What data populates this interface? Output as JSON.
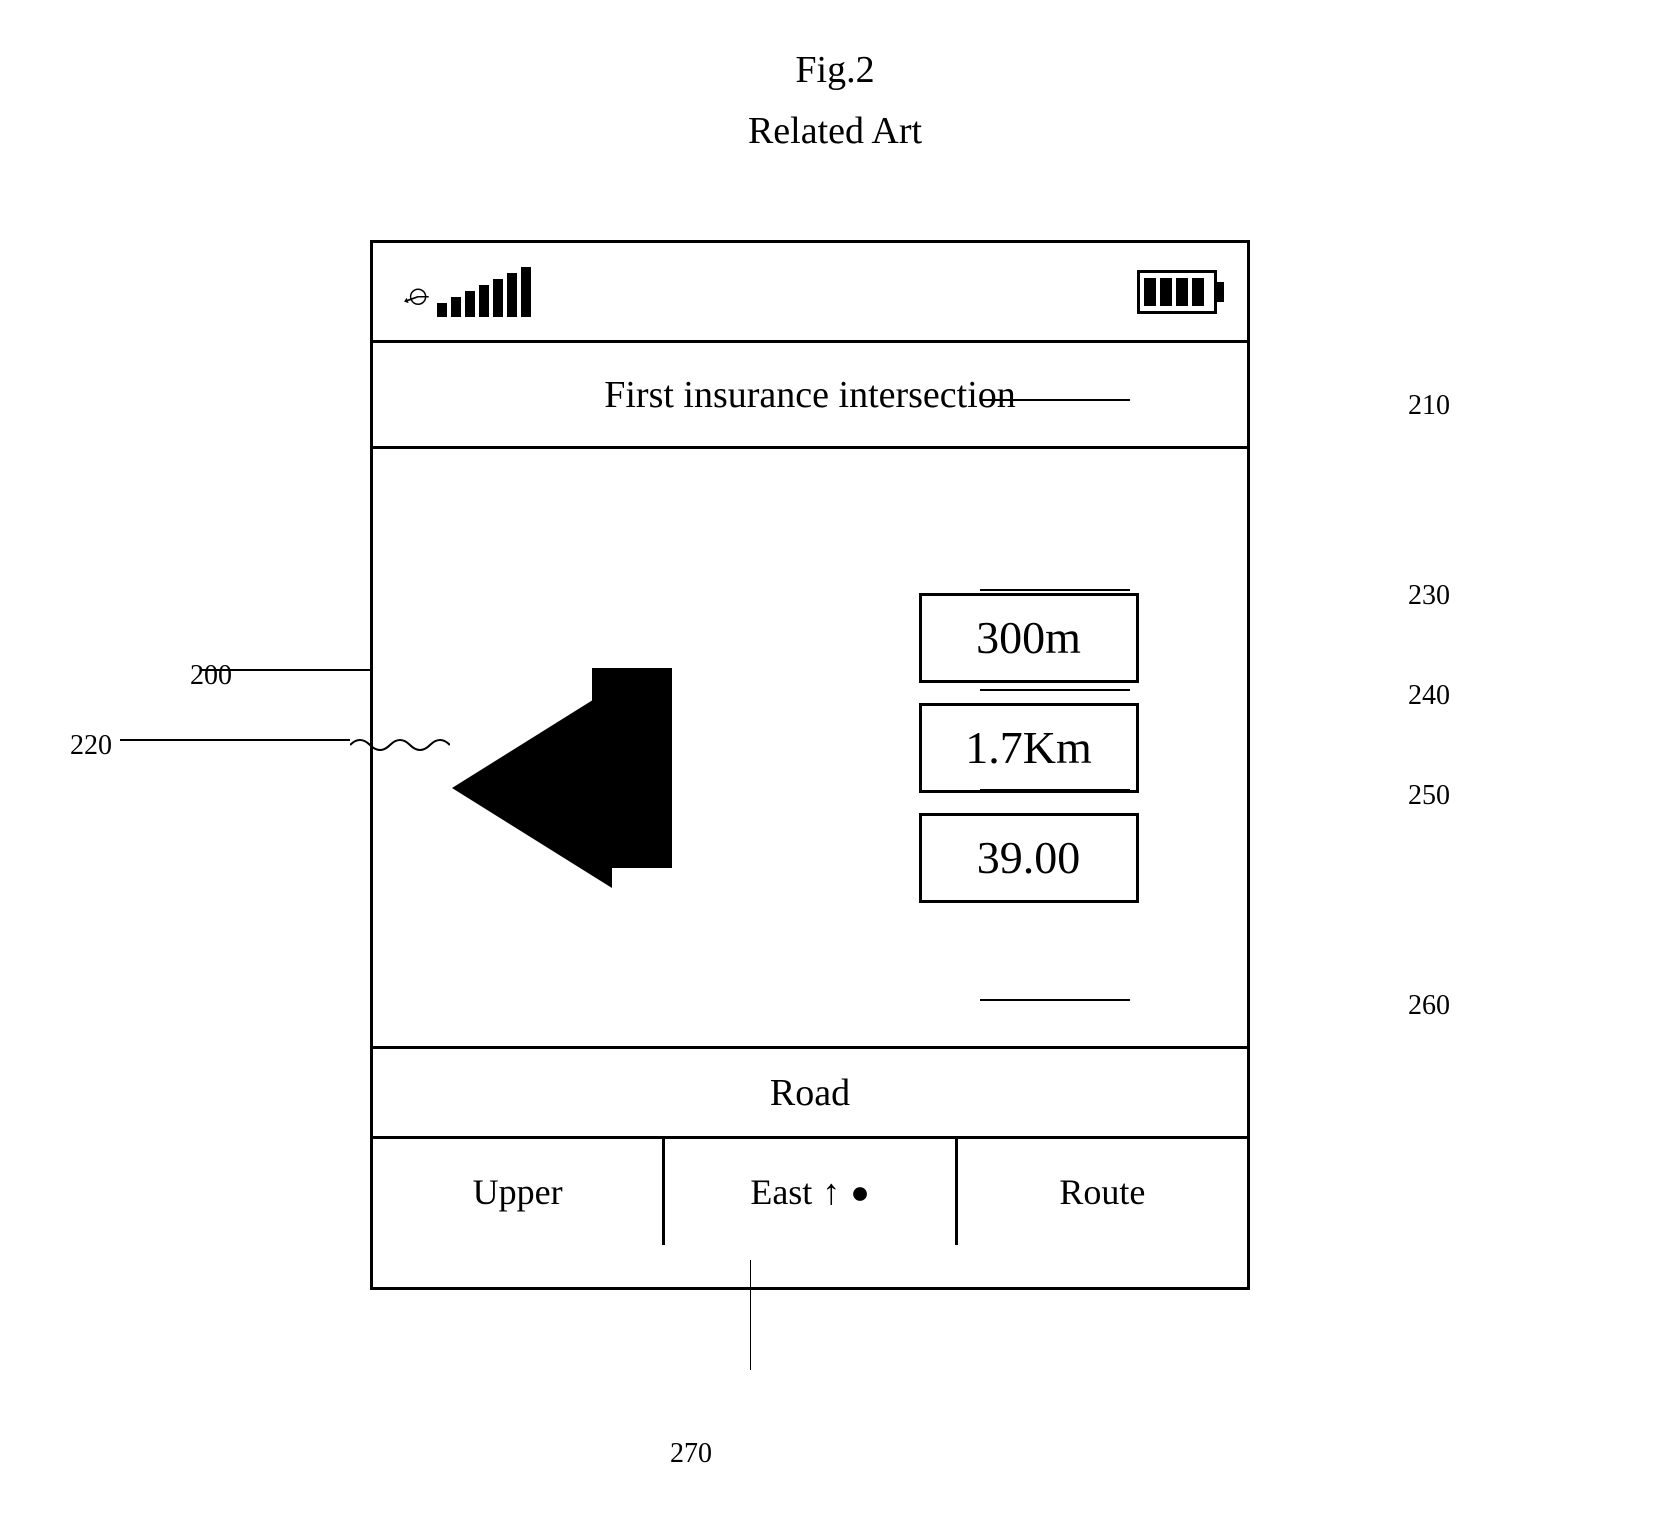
{
  "title": {
    "line1": "Fig.2",
    "line2": "Related Art"
  },
  "device": {
    "status": {
      "signal_bars": [
        12,
        18,
        24,
        30,
        36,
        42,
        48
      ],
      "battery_segments": 4
    },
    "intersection_label": "First insurance intersection",
    "info_boxes": [
      {
        "id": "230",
        "value": "300m"
      },
      {
        "id": "240",
        "value": "1.7Km"
      },
      {
        "id": "250",
        "value": "39.00"
      }
    ],
    "road_label": "Road",
    "bottom_nav": {
      "left_label": "Upper",
      "center_label": "East",
      "right_label": "Route"
    }
  },
  "annotations": {
    "a200": "200",
    "a210": "210",
    "a220": "220",
    "a230": "230",
    "a240": "240",
    "a250": "250",
    "a260": "260",
    "a270": "270"
  }
}
